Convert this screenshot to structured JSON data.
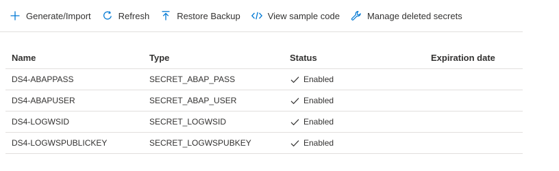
{
  "toolbar": {
    "generate_import": {
      "label": "Generate/Import",
      "icon": "plus-icon"
    },
    "refresh": {
      "label": "Refresh",
      "icon": "refresh-icon"
    },
    "restore_backup": {
      "label": "Restore Backup",
      "icon": "upload-arrow-icon"
    },
    "view_sample_code": {
      "label": "View sample code",
      "icon": "code-icon"
    },
    "manage_deleted": {
      "label": "Manage deleted secrets",
      "icon": "wrench-icon"
    }
  },
  "table": {
    "columns": [
      "Name",
      "Type",
      "Status",
      "Expiration date"
    ],
    "rows": [
      {
        "name": "DS4-ABAPPASS",
        "type": "SECRET_ABAP_PASS",
        "status": "Enabled",
        "expiration": ""
      },
      {
        "name": "DS4-ABAPUSER",
        "type": "SECRET_ABAP_USER",
        "status": "Enabled",
        "expiration": ""
      },
      {
        "name": "DS4-LOGWSID",
        "type": "SECRET_LOGWSID",
        "status": "Enabled",
        "expiration": ""
      },
      {
        "name": "DS4-LOGWSPUBLICKEY",
        "type": "SECRET_LOGWSPUBKEY",
        "status": "Enabled",
        "expiration": ""
      }
    ]
  },
  "colors": {
    "accent": "#0078d4",
    "text": "#323130",
    "divider": "#e1dfdd"
  }
}
